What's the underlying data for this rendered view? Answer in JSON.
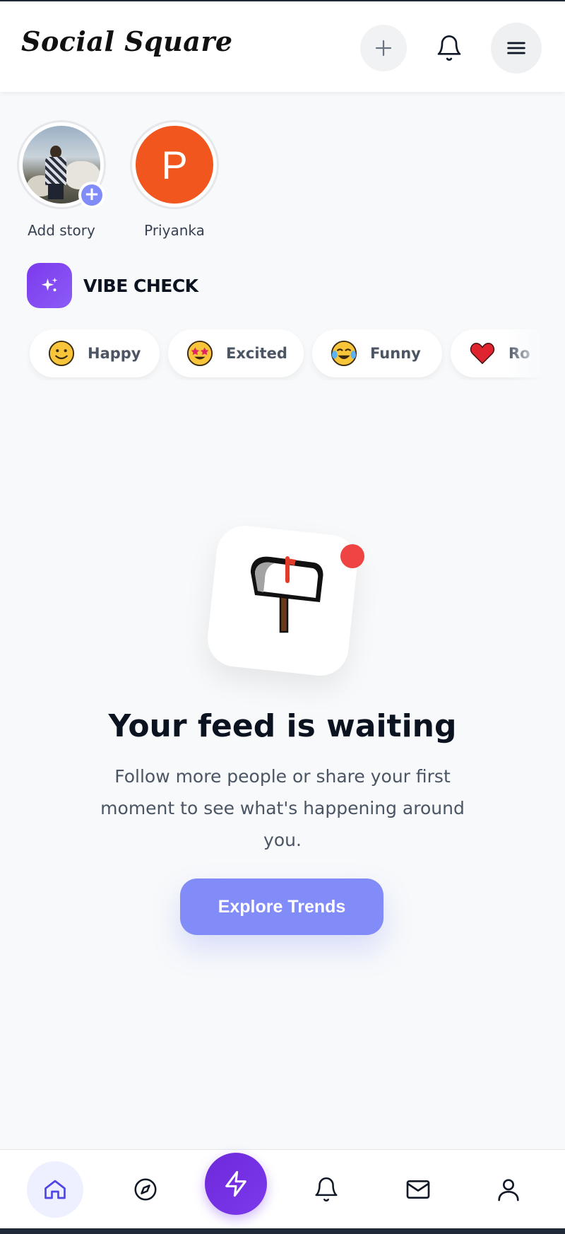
{
  "app": {
    "title": "Social Square"
  },
  "header": {
    "create_icon": "plus-icon",
    "notifications_icon": "bell-icon",
    "menu_icon": "hamburger-menu-icon"
  },
  "stories": [
    {
      "label": "Add story",
      "type": "add"
    },
    {
      "label": "Priyanka",
      "initial": "P",
      "color": "#f1561f"
    }
  ],
  "vibe_check": {
    "title": "VIBE CHECK",
    "moods": [
      {
        "label": "Happy",
        "emoji": "slightly-smiling-face"
      },
      {
        "label": "Excited",
        "emoji": "star-struck-face"
      },
      {
        "label": "Funny",
        "emoji": "tears-of-joy-face"
      },
      {
        "label": "Ro",
        "emoji": "red-heart"
      }
    ]
  },
  "empty_state": {
    "title": "Your feed is waiting",
    "text": "Follow more people or share your first moment to see what's happening around you.",
    "button": "Explore Trends"
  },
  "bottom_nav": [
    {
      "name": "home",
      "icon": "home-icon",
      "active": true
    },
    {
      "name": "explore",
      "icon": "compass-icon"
    },
    {
      "name": "create",
      "icon": "lightning-icon"
    },
    {
      "name": "notifications",
      "icon": "bell-icon"
    },
    {
      "name": "messages",
      "icon": "mail-icon"
    },
    {
      "name": "profile",
      "icon": "user-icon"
    }
  ],
  "colors": {
    "accent": "#818cf8",
    "vibe": "#7c3aed",
    "notification_dot": "#ef4444",
    "avatar": "#f1561f"
  }
}
